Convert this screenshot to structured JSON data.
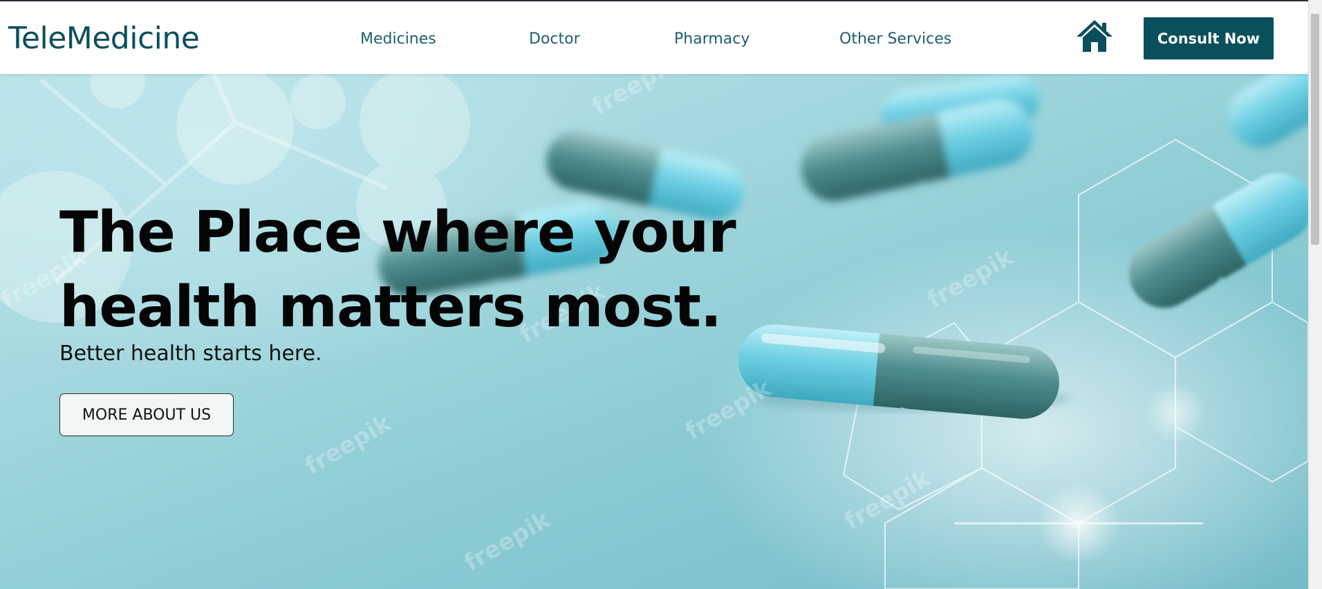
{
  "navbar": {
    "brand": "TeleMedicine",
    "links": [
      "Medicines",
      "Doctor",
      "Pharmacy",
      "Other Services"
    ],
    "home_icon": "home-icon",
    "consult_label": "Consult Now"
  },
  "hero": {
    "headline": "The Place where your health matters most.",
    "subline": "Better health starts here.",
    "button_label": "MORE ABOUT US",
    "watermark": "freepik"
  },
  "colors": {
    "brand": "#0a4f5c",
    "hero_bg": "#8ccbd4",
    "capsule_light": "#6fd0e4",
    "capsule_dark": "#3f7d7f"
  }
}
